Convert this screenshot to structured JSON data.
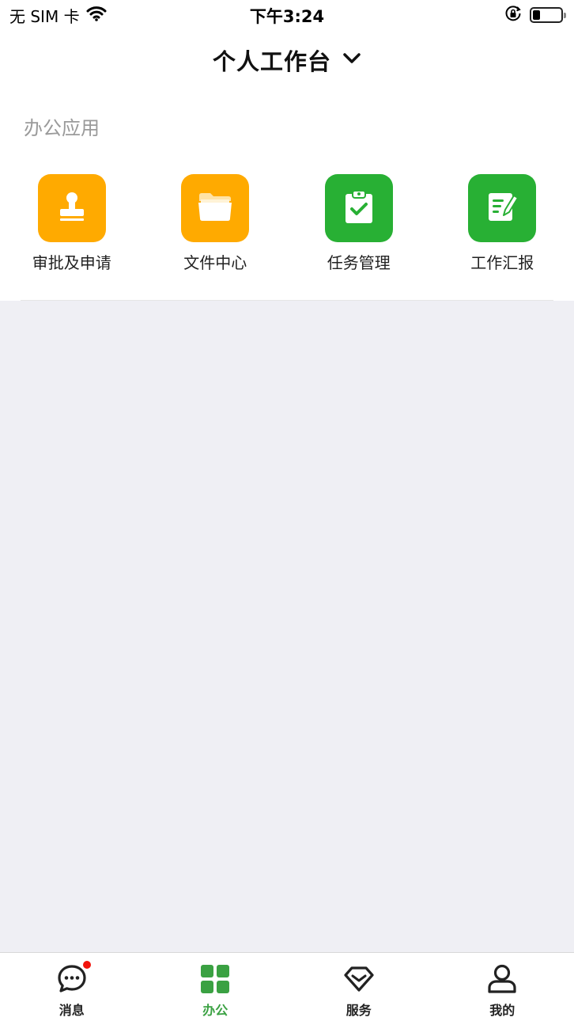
{
  "status_bar": {
    "carrier": "无 SIM 卡",
    "time": "下午3:24",
    "battery_level_percent": 25
  },
  "header": {
    "title": "个人工作台",
    "dropdown_icon": "chevron-down-icon"
  },
  "section": {
    "title": "办公应用"
  },
  "apps": [
    {
      "label": "审批及申请",
      "icon": "stamp-icon",
      "color": "#ffaa00"
    },
    {
      "label": "文件中心",
      "icon": "folder-icon",
      "color": "#ffaa00"
    },
    {
      "label": "任务管理",
      "icon": "clipboard-check-icon",
      "color": "#28b034"
    },
    {
      "label": "工作汇报",
      "icon": "edit-report-icon",
      "color": "#28b034"
    }
  ],
  "tab_bar": {
    "items": [
      {
        "label": "消息",
        "icon": "message-icon",
        "badge": true
      },
      {
        "label": "办公",
        "icon": "grid-icon",
        "active": true
      },
      {
        "label": "服务",
        "icon": "diamond-icon"
      },
      {
        "label": "我的",
        "icon": "user-icon"
      }
    ]
  },
  "colors": {
    "accent_green": "#3aa142",
    "app_orange": "#ffaa00",
    "app_green": "#28b034",
    "badge_red": "#f2140c",
    "background_gray": "#efeff4"
  }
}
